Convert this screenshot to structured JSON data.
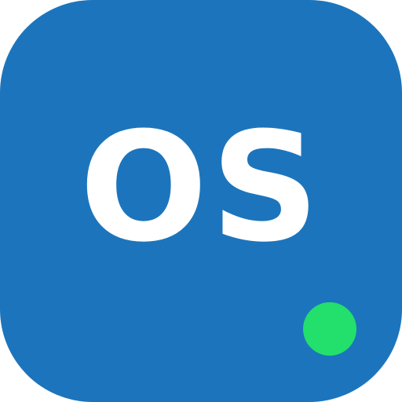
{
  "icon": {
    "label": "OS",
    "background_color": "#1c75bc",
    "label_color": "#ffffff"
  },
  "status_indicator": {
    "state": "online",
    "color": "#22e06b"
  }
}
